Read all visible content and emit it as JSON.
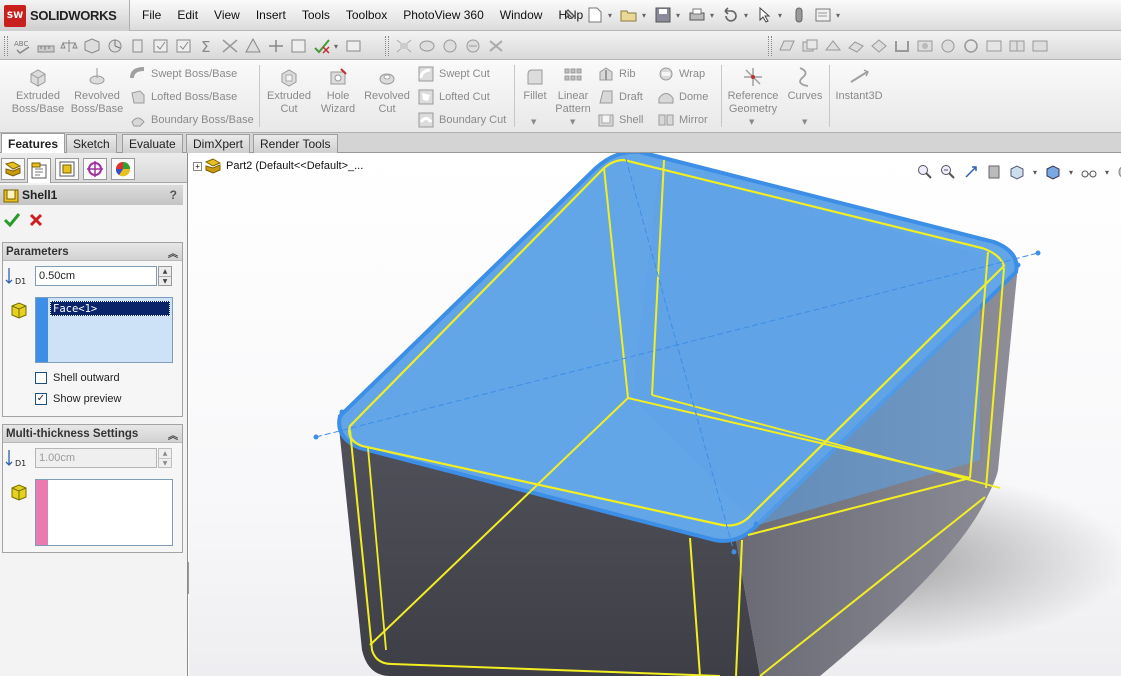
{
  "app": {
    "logo_text": "SOLIDWORKS",
    "logo_mark": "SW"
  },
  "menu": [
    "File",
    "Edit",
    "View",
    "Insert",
    "Tools",
    "Toolbox",
    "PhotoView 360",
    "Window",
    "Help"
  ],
  "command_manager": {
    "extruded_boss": "Extruded Boss/Base",
    "revolved_boss": "Revolved Boss/Base",
    "swept_boss": "Swept Boss/Base",
    "lofted_boss": "Lofted Boss/Base",
    "boundary_boss": "Boundary Boss/Base",
    "extruded_cut": "Extruded Cut",
    "hole_wizard": "Hole Wizard",
    "revolved_cut": "Revolved Cut",
    "swept_cut": "Swept Cut",
    "lofted_cut": "Lofted Cut",
    "boundary_cut": "Boundary Cut",
    "fillet": "Fillet",
    "linear_pattern": "Linear Pattern",
    "rib": "Rib",
    "draft": "Draft",
    "shell": "Shell",
    "wrap": "Wrap",
    "dome": "Dome",
    "mirror": "Mirror",
    "reference_geometry": "Reference Geometry",
    "curves": "Curves",
    "instant3d": "Instant3D"
  },
  "tabs": [
    "Features",
    "Sketch",
    "Evaluate",
    "DimXpert",
    "Render Tools"
  ],
  "property_manager": {
    "title": "Shell1",
    "help": "?",
    "parameters": {
      "heading": "Parameters",
      "thickness": "0.50cm",
      "faces": [
        "Face<1>"
      ],
      "shell_outward_label": "Shell outward",
      "shell_outward_checked": false,
      "show_preview_label": "Show preview",
      "show_preview_checked": true
    },
    "multi_thickness": {
      "heading": "Multi-thickness Settings",
      "thickness": "1.00cm",
      "faces": []
    },
    "d1_label": "D1"
  },
  "feature_tree": {
    "root": "Part2  (Default<<Default>_..."
  },
  "colors": {
    "face_select": "#5da3e6",
    "edge_highlight": "#f2ee22",
    "body_side": "#4f4f5a",
    "accent_red": "#c8201c"
  }
}
